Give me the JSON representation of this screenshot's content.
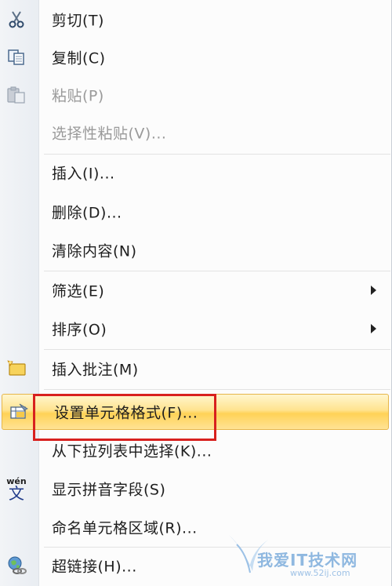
{
  "menu": {
    "items": [
      {
        "label": "剪切(T)",
        "icon": "scissors-icon"
      },
      {
        "label": "复制(C)",
        "icon": "copy-icon"
      },
      {
        "label": "粘贴(P)",
        "icon": "paste-icon"
      },
      {
        "label": "选择性粘贴(V)..."
      },
      {
        "label": "插入(I)..."
      },
      {
        "label": "删除(D)..."
      },
      {
        "label": "清除内容(N)"
      },
      {
        "label": "筛选(E)"
      },
      {
        "label": "排序(O)"
      },
      {
        "label": "插入批注(M)",
        "icon": "insert-comment-icon"
      },
      {
        "label": "设置单元格格式(F)...",
        "icon": "format-cells-icon"
      },
      {
        "label": "从下拉列表中选择(K)..."
      },
      {
        "label": "显示拼音字段(S)",
        "icon": "phonetic-icon",
        "icon_text": "wén"
      },
      {
        "label": "命名单元格区域(R)..."
      },
      {
        "label": "超链接(H)...",
        "icon": "hyperlink-icon"
      }
    ],
    "highlight_color": "#ffd257",
    "annotation_color": "#d8201e"
  },
  "watermark": {
    "text": "我爱IT技术网",
    "sub": "www.52ij.com"
  }
}
